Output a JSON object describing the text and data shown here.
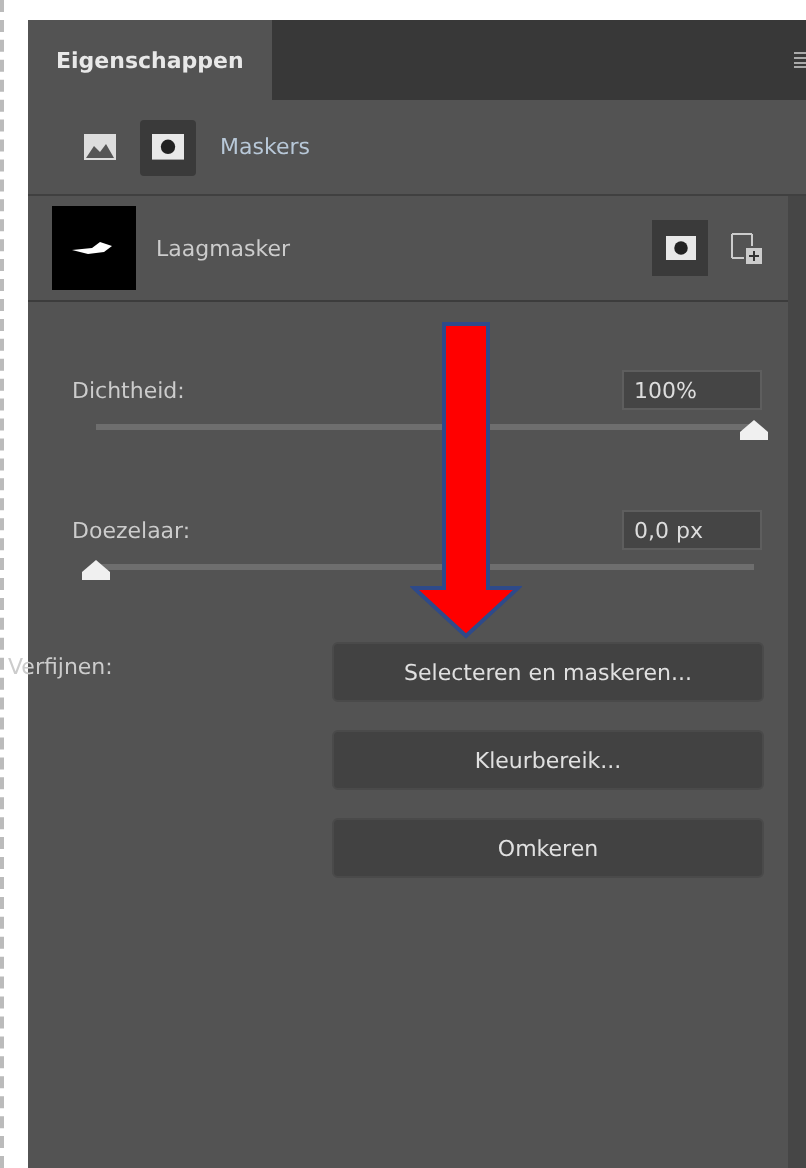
{
  "tabs": [
    {
      "label": "Eigenschappen",
      "selected": true
    }
  ],
  "section": {
    "title": "Maskers",
    "modes": [
      {
        "kind": "pixel",
        "selected": false
      },
      {
        "kind": "mask",
        "selected": true
      }
    ]
  },
  "layer": {
    "name": "Laagmasker"
  },
  "sliders": [
    {
      "label": "Dichtheid:",
      "value": "100%",
      "level": 1
    },
    {
      "label": "Doezelaar:",
      "value": "0,0 px",
      "level": 0
    }
  ],
  "refine": {
    "label": "Verfijnen:",
    "buttons": [
      "Selecteren en maskeren...",
      "Kleurbereik...",
      "Omkeren"
    ]
  }
}
